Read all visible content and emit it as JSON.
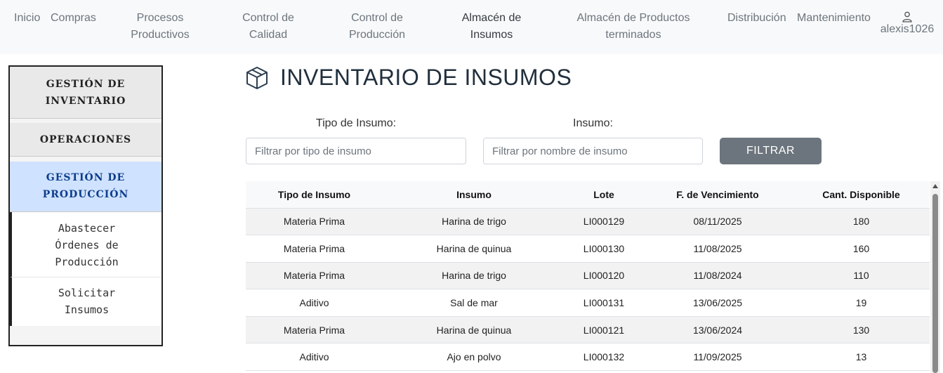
{
  "nav": {
    "items": [
      {
        "label_line1": "Inicio",
        "label_line2": ""
      },
      {
        "label_line1": "Compras",
        "label_line2": ""
      },
      {
        "label_line1": "Procesos",
        "label_line2": "Productivos"
      },
      {
        "label_line1": "Control de",
        "label_line2": "Calidad"
      },
      {
        "label_line1": "Control de",
        "label_line2": "Producción"
      },
      {
        "label_line1": "Almacén de",
        "label_line2": "Insumos"
      },
      {
        "label_line1": "Almacén de Productos",
        "label_line2": "terminados"
      },
      {
        "label_line1": "Distribución",
        "label_line2": ""
      },
      {
        "label_line1": "Mantenimiento",
        "label_line2": ""
      }
    ],
    "user": {
      "name": "alexis1026",
      "icon": "user-icon"
    }
  },
  "sidebar": {
    "sections": [
      {
        "line1": "GESTIÓN DE",
        "line2": "INVENTARIO"
      },
      {
        "line1": "OPERACIONES",
        "line2": ""
      },
      {
        "line1": "GESTIÓN DE",
        "line2": "PRODUCCIÓN"
      }
    ],
    "subitems": [
      {
        "line1": "Abastecer",
        "line2": "Órdenes de",
        "line3": "Producción"
      },
      {
        "line1": "Solicitar",
        "line2": "Insumos",
        "line3": ""
      }
    ]
  },
  "page": {
    "title": "INVENTARIO DE INSUMOS",
    "title_icon": "box-icon"
  },
  "filters": {
    "type_label": "Tipo de Insumo:",
    "type_placeholder": "Filtrar por tipo de insumo",
    "name_label": "Insumo:",
    "name_placeholder": "Filtrar por nombre de insumo",
    "button": "FILTRAR"
  },
  "table": {
    "headers": [
      "Tipo de Insumo",
      "Insumo",
      "Lote",
      "F. de Vencimiento",
      "Cant. Disponible"
    ],
    "rows": [
      [
        "Materia Prima",
        "Harina de trigo",
        "LI000129",
        "08/11/2025",
        "180"
      ],
      [
        "Materia Prima",
        "Harina de quinua",
        "LI000130",
        "11/08/2025",
        "160"
      ],
      [
        "Materia Prima",
        "Harina de trigo",
        "LI000120",
        "11/08/2024",
        "110"
      ],
      [
        "Aditivo",
        "Sal de mar",
        "LI000131",
        "13/06/2025",
        "19"
      ],
      [
        "Materia Prima",
        "Harina de quinua",
        "LI000121",
        "13/06/2024",
        "130"
      ],
      [
        "Aditivo",
        "Ajo en polvo",
        "LI000132",
        "11/09/2025",
        "13"
      ]
    ]
  }
}
